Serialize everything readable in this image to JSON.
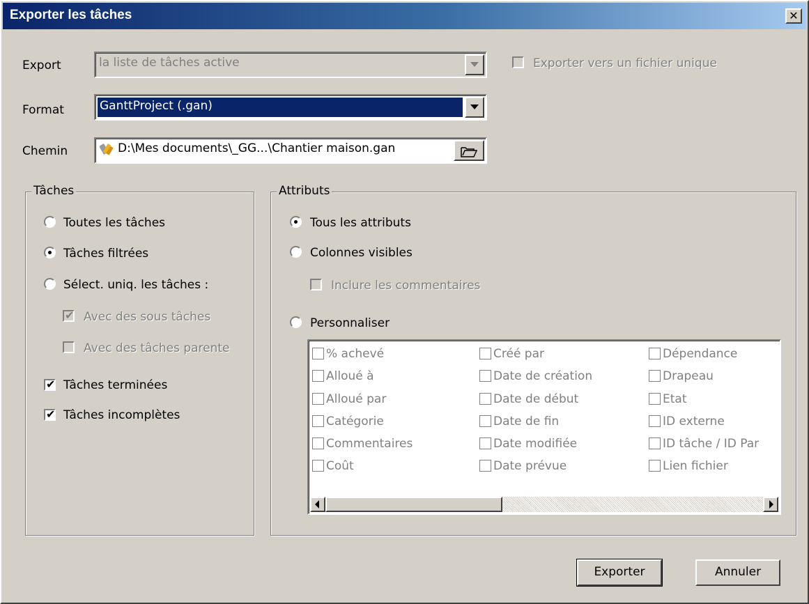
{
  "window": {
    "title": "Exporter les tâches",
    "close_glyph": "✕"
  },
  "export": {
    "label": "Export",
    "value": "la liste de tâches active",
    "single_file_label": "Exporter vers un fichier unique",
    "single_file_checked": false
  },
  "format": {
    "label": "Format",
    "value": "GanttProject (.gan)"
  },
  "path": {
    "label": "Chemin",
    "value": "D:\\Mes documents\\_GG...\\Chantier maison.gan",
    "icon": "gantt-file-icon",
    "browse_icon": "folder-open-icon"
  },
  "tasks": {
    "legend": "Tâches",
    "options": [
      {
        "label": "Toutes les tâches",
        "selected": false
      },
      {
        "label": "Tâches filtrées",
        "selected": true
      },
      {
        "label": "Sélect. uniq. les tâches :",
        "selected": false
      }
    ],
    "sub_options": [
      {
        "label": "Avec des sous tâches",
        "checked": true,
        "enabled": false
      },
      {
        "label": "Avec des tâches parente",
        "checked": false,
        "enabled": false
      }
    ],
    "checks": [
      {
        "label": "Tâches terminées",
        "checked": true
      },
      {
        "label": "Tâches incomplètes",
        "checked": true
      }
    ]
  },
  "attributes": {
    "legend": "Attributs",
    "all_label": "Tous les attributs",
    "visible_label": "Colonnes visibles",
    "include_comments_label": "Inclure les commentaires",
    "custom_label": "Personnaliser",
    "selected": "all",
    "columns": [
      [
        "% achevé",
        "Alloué à",
        "Alloué par",
        "Catégorie",
        "Commentaires",
        "Coût"
      ],
      [
        "Créé par",
        "Date de création",
        "Date de début",
        "Date de fin",
        "Date modifiée",
        "Date prévue"
      ],
      [
        "Dépendance",
        "Drapeau",
        "Etat",
        "ID externe",
        "ID tâche / ID Par",
        "Lien fichier"
      ]
    ]
  },
  "buttons": {
    "export": "Exporter",
    "cancel": "Annuler"
  }
}
